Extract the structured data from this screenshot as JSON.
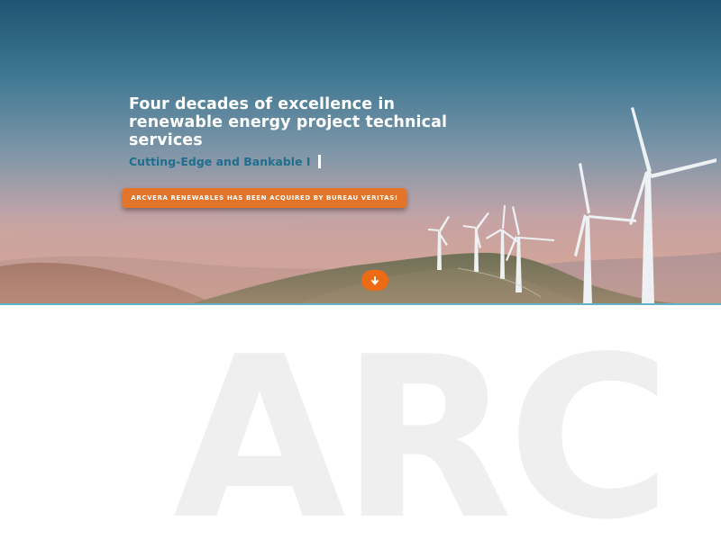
{
  "hero": {
    "headline": "Four decades of excellence in renewable energy project technical services",
    "tagline": "Cutting-Edge and Bankable I",
    "announcement_button": "ARCVERA RENEWABLES HAS BEEN ACQUIRED BY BUREAU VERITAS!",
    "scroll_icon": "arrow-down-icon",
    "accent_color": "#ee6b16",
    "tagline_color": "#1e6e8e"
  },
  "watermark": {
    "text": "ARC"
  }
}
